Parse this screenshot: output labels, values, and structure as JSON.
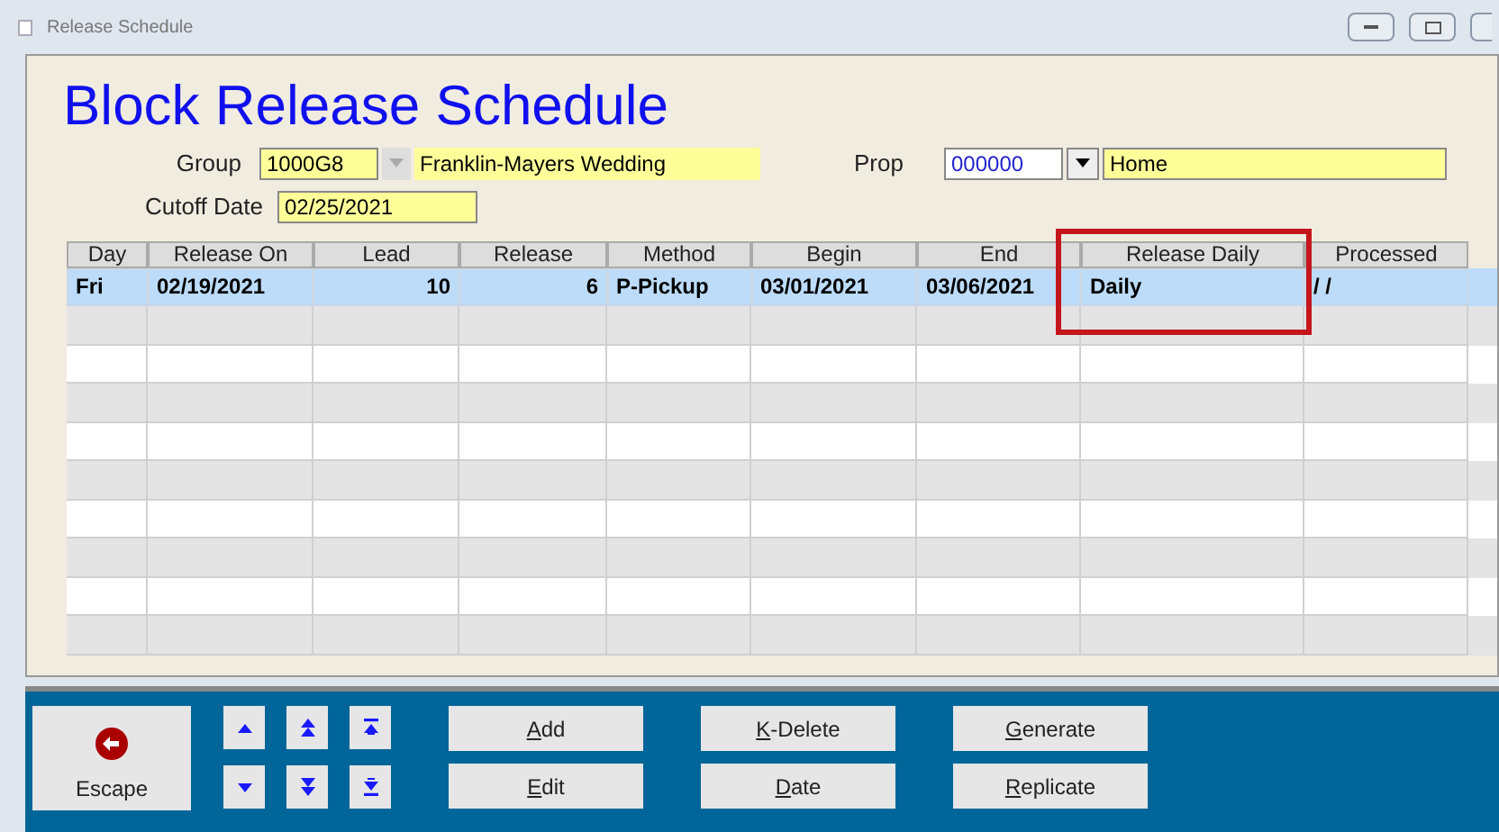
{
  "window": {
    "title": "Release Schedule"
  },
  "heading": "Block Release Schedule",
  "group": {
    "label": "Group",
    "code": "1000G8",
    "name": "Franklin-Mayers Wedding"
  },
  "prop": {
    "label": "Prop",
    "code": "000000",
    "name": "Home"
  },
  "cutoff": {
    "label": "Cutoff Date",
    "value": "02/25/2021"
  },
  "table": {
    "columns": [
      {
        "label": "Day"
      },
      {
        "label": "Release On"
      },
      {
        "label": "Lead"
      },
      {
        "label": "Release"
      },
      {
        "label": "Method"
      },
      {
        "label": "Begin"
      },
      {
        "label": "End"
      },
      {
        "label": "Release Daily",
        "highlighted": true
      },
      {
        "label": "Processed"
      }
    ],
    "rows": [
      {
        "selected": true,
        "cells": [
          "Fri",
          "02/19/2021",
          "10",
          "6",
          "P-Pickup",
          "03/01/2021",
          "03/06/2021",
          "Daily",
          "/ /"
        ]
      }
    ]
  },
  "escape": {
    "label": "Escape"
  },
  "nav_buttons": [
    {
      "kind": "up"
    },
    {
      "kind": "page-up"
    },
    {
      "kind": "top"
    },
    {
      "kind": "down"
    },
    {
      "kind": "page-down"
    },
    {
      "kind": "bottom"
    }
  ],
  "buttons": [
    {
      "hotkey": "A",
      "rest": "dd"
    },
    {
      "hotkey": "K",
      "rest": "-Delete"
    },
    {
      "hotkey": "G",
      "rest": "enerate"
    },
    {
      "hotkey": "E",
      "rest": "dit"
    },
    {
      "hotkey": "D",
      "rest": "ate"
    },
    {
      "hotkey": "R",
      "rest": "eplicate"
    }
  ]
}
